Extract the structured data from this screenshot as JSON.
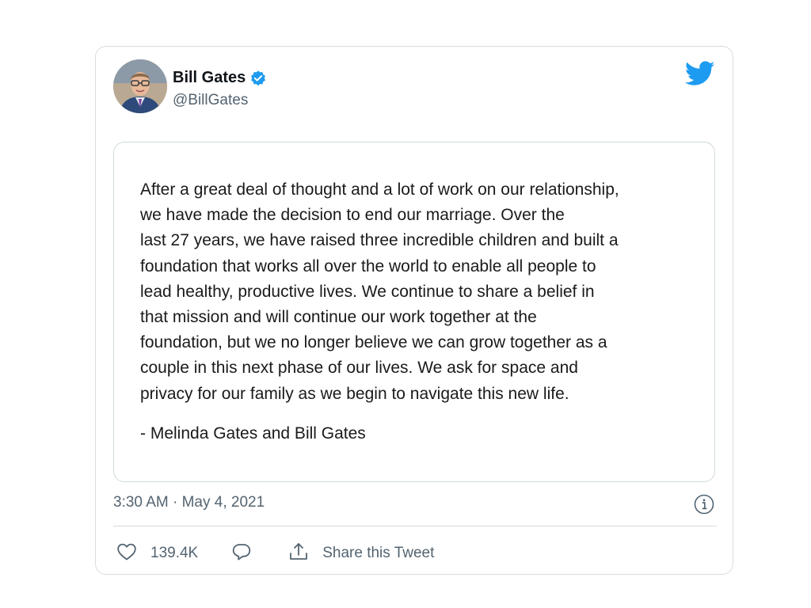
{
  "user": {
    "display_name": "Bill Gates",
    "handle": "@BillGates",
    "verified": true,
    "avatar": "bill-gates-portrait"
  },
  "tweet": {
    "statement": "After a great deal of thought and a lot of work on our relationship,\nwe have made the decision to end our marriage. Over the\nlast 27 years, we have raised three incredible children and built a\nfoundation that works all over the world to enable all people to\nlead healthy, productive lives. We continue to share a belief in\nthat mission and will continue our work together at the\nfoundation, but we no longer believe we can grow together as a\ncouple in this next phase of our lives. We ask for space and\nprivacy for our family as we begin to navigate this new life.",
    "signature": "- Melinda Gates and Bill Gates",
    "timestamp": "3:30 AM · May 4, 2021"
  },
  "actions": {
    "like_count": "139.4K",
    "share_label": "Share this Tweet"
  },
  "icons": {
    "brand": "twitter-bird-icon",
    "verified": "verified-badge-icon",
    "info": "info-icon",
    "like": "heart-icon",
    "reply": "reply-bubble-icon",
    "share": "share-icon"
  },
  "colors": {
    "twitter_blue": "#1d9bf0",
    "text_primary": "#0f1419",
    "text_secondary": "#536471",
    "border": "#cfd9de"
  }
}
